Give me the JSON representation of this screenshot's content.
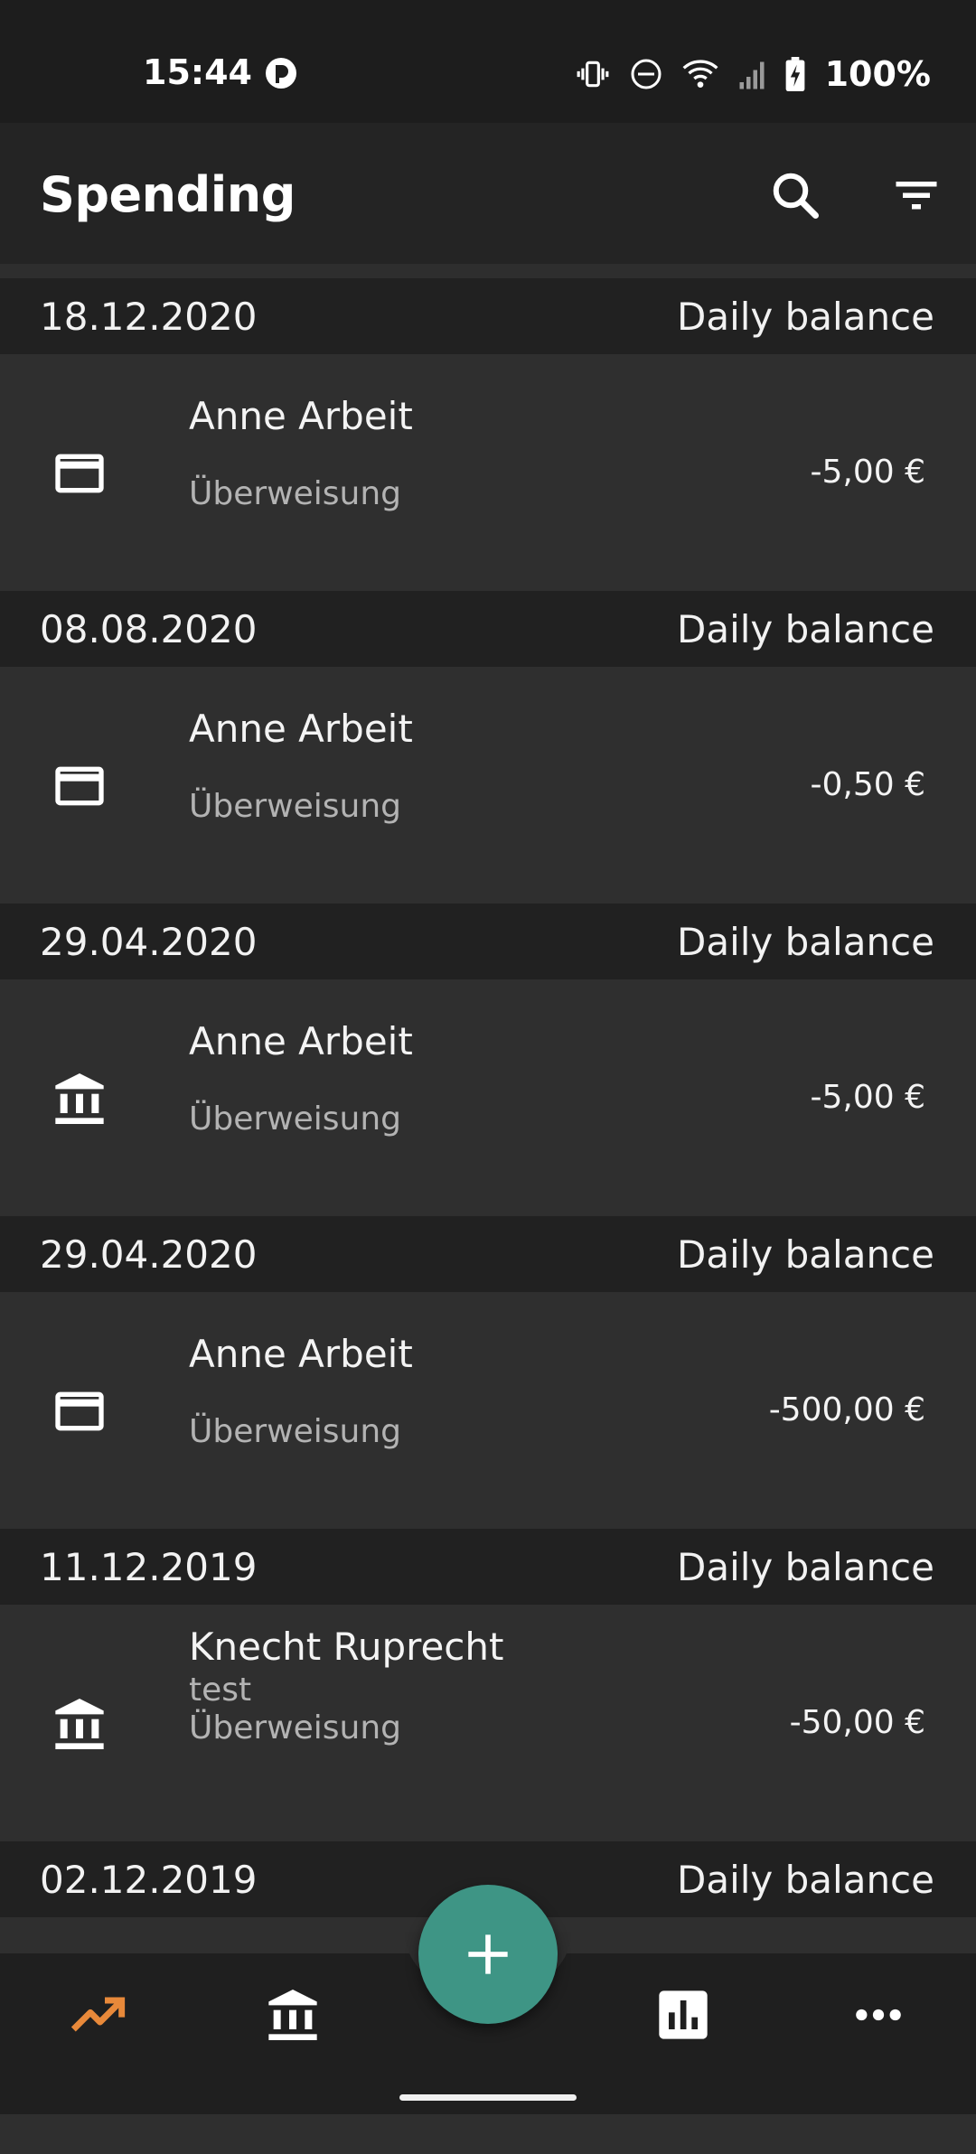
{
  "status_bar": {
    "time": "15:44",
    "battery": "100%",
    "icons": [
      "app-notification-icon",
      "vibrate-icon",
      "do-not-disturb-icon",
      "wifi-icon",
      "signal-icon",
      "battery-charging-icon"
    ]
  },
  "app_bar": {
    "title": "Spending",
    "actions": [
      "search-icon",
      "filter-icon"
    ]
  },
  "transactions": [
    {
      "date": "18.12.2020",
      "balance_label": "Daily balance",
      "icon": "credit-card-icon",
      "name": "Anne Arbeit",
      "type": "Überweisung",
      "amount": "-5,00 €"
    },
    {
      "date": "08.08.2020",
      "balance_label": "Daily balance",
      "icon": "credit-card-icon",
      "name": "Anne Arbeit",
      "type": "Überweisung",
      "amount": "-0,50 €"
    },
    {
      "date": "29.04.2020",
      "balance_label": "Daily balance",
      "icon": "bank-icon",
      "name": "Anne Arbeit",
      "type": "Überweisung",
      "amount": "-5,00 €"
    },
    {
      "date": "29.04.2020",
      "balance_label": "Daily balance",
      "icon": "credit-card-icon",
      "name": "Anne Arbeit",
      "type": "Überweisung",
      "amount": "-500,00 €"
    },
    {
      "date": "11.12.2019",
      "balance_label": "Daily balance",
      "icon": "bank-icon",
      "name": "Knecht Ruprecht",
      "memo": "test",
      "type": "Überweisung",
      "amount": "-50,00 €"
    },
    {
      "date": "02.12.2019",
      "balance_label": "Daily balance"
    }
  ],
  "bottom_nav": {
    "items": [
      "trending-up-icon",
      "bank-icon",
      "add-icon",
      "bar-chart-icon",
      "more-icon"
    ],
    "active": "trending-up-icon",
    "colors": {
      "active": "#e8893a",
      "fab": "#3e9585"
    }
  }
}
